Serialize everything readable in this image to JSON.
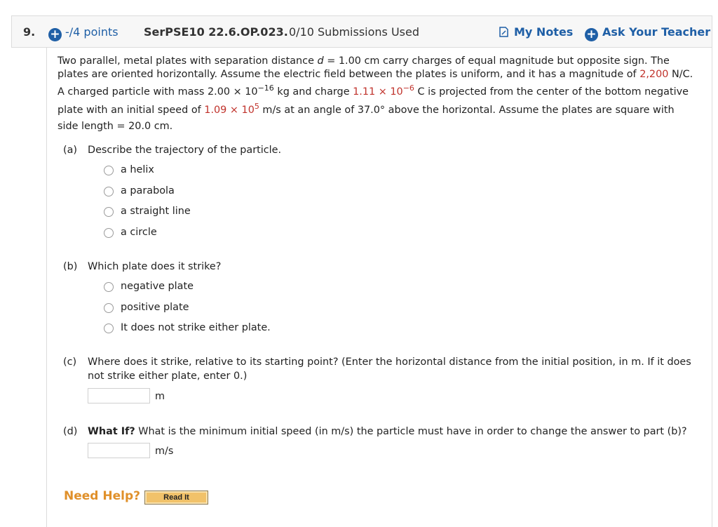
{
  "header": {
    "question_number": "9.",
    "points": "-/4 points",
    "question_code": "SerPSE10 22.6.OP.023.",
    "submissions": "0/10 Submissions Used",
    "my_notes": "My Notes",
    "ask_teacher": "Ask Your Teacher"
  },
  "problem": {
    "l1": "Two parallel, metal plates with separation distance ",
    "l1_var": "d",
    "l1_b": " = 1.00 cm carry charges of equal magnitude but opposite sign. The",
    "l2a": "plates are oriented horizontally. Assume the electric field between the plates is uniform, and it has a magnitude of ",
    "l2_val": "2,200",
    "l2b": " N/C.",
    "l3a": "A charged particle with mass 2.00 × 10",
    "l3_exp1": "−16",
    "l3b": " kg and charge ",
    "l3_val": "1.11 × 10",
    "l3_exp2": "−6",
    "l3c": " C is projected from the center of the bottom negative",
    "l4a": "plate with an initial speed of ",
    "l4_val": "1.09 × 10",
    "l4_exp": "5",
    "l4b": " m/s at an angle of 37.0° above the horizontal. Assume the plates are square with",
    "l5": "side length = 20.0 cm."
  },
  "part_a": {
    "label": "(a)",
    "question": "Describe the trajectory of the particle.",
    "options": [
      "a helix",
      "a parabola",
      "a straight line",
      "a circle"
    ]
  },
  "part_b": {
    "label": "(b)",
    "question": "Which plate does it strike?",
    "options": [
      "negative plate",
      "positive plate",
      "It does not strike either plate."
    ]
  },
  "part_c": {
    "label": "(c)",
    "question_l1": "Where does it strike, relative to its starting point? (Enter the horizontal distance from the initial position, in m. If it does",
    "question_l2": "not strike either plate, enter 0.)",
    "unit": "m",
    "value": ""
  },
  "part_d": {
    "label": "(d)",
    "bold": "What If?",
    "question": " What is the minimum initial speed (in m/s) the particle must have in order to change the answer to part (b)?",
    "unit": "m/s",
    "value": ""
  },
  "help": {
    "need_help": "Need Help?",
    "read_it": "Read It"
  }
}
